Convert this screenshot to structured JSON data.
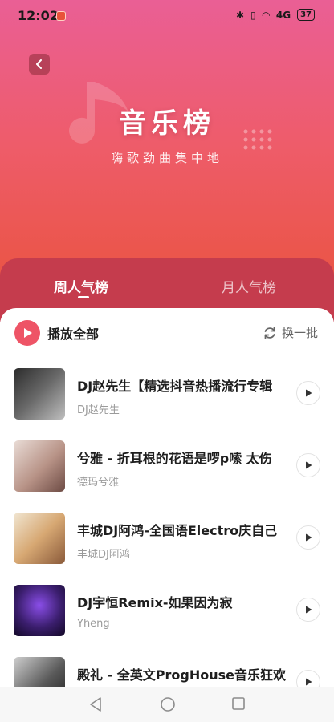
{
  "status_bar": {
    "time": "12:02",
    "signal_text": "4G",
    "battery": "37"
  },
  "hero": {
    "title": "音乐榜",
    "subtitle": "嗨歌劲曲集中地"
  },
  "tabs": [
    {
      "label": "周人气榜",
      "active": true
    },
    {
      "label": "月人气榜",
      "active": false
    }
  ],
  "toolbar": {
    "play_all_label": "播放全部",
    "shuffle_label": "换一批"
  },
  "songs": [
    {
      "title": "DJ赵先生【精选抖音热播流行专辑",
      "artist": "DJ赵先生",
      "cover_color": "#3a3a3a"
    },
    {
      "title": "兮雅 - 折耳根的花语是啰p嗦 太伤",
      "artist": "德玛兮雅",
      "cover_color": "#c8a9a1"
    },
    {
      "title": "丰城DJ阿鸿-全国语Electro庆自己",
      "artist": "丰城DJ阿鸿",
      "cover_color": "#d9b48a"
    },
    {
      "title": "DJ宇恒Remix-如果因为寂",
      "artist": "Yheng",
      "cover_color": "#3b1e6e"
    },
    {
      "title": "殿礼 - 全英文ProgHouse音乐狂欢",
      "artist": "",
      "cover_color": "#555555"
    }
  ],
  "colors": {
    "accent": "#ee5466",
    "tab_bg": "#c53c4d"
  }
}
